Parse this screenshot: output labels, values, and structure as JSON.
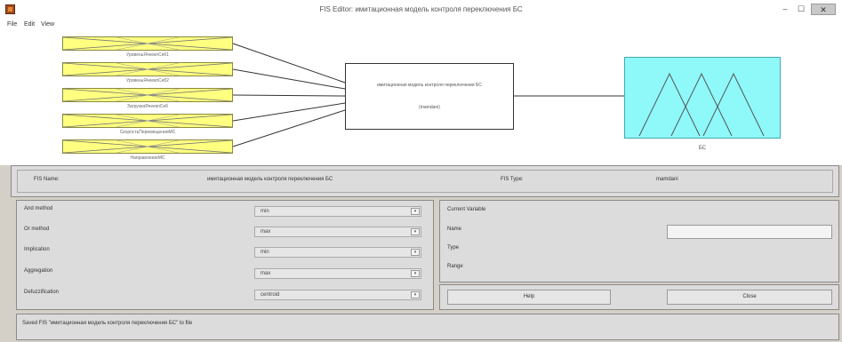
{
  "window": {
    "title": "FIS Editor: имитационная модель контроля переключения БС",
    "min_glyph": "‒",
    "max_glyph": "☐",
    "close_glyph": "✕"
  },
  "menu": [
    "File",
    "Edit",
    "View"
  ],
  "diagram": {
    "inputs": [
      "УровеньЯчеекпСеб1",
      "УровеньЯчеекпСеб2",
      "ЗагрузкаЯчеекпСеб",
      "СкоростьПеремещенияМС",
      "НаправлениеМС"
    ],
    "system_name": "имитационная модель контроля переключения БС",
    "system_type": "(mamdani)",
    "output": "БС",
    "colors": {
      "input_fill": "#ffff80",
      "output_fill": "#8ff8f8"
    }
  },
  "fis_info": {
    "name_label": "FIS Name:",
    "name_value": "имитационная модель контроля переключения БС",
    "type_label": "FIS Type:",
    "type_value": "mamdani"
  },
  "methods": [
    {
      "label": "And method",
      "value": "min"
    },
    {
      "label": "Or method",
      "value": "max"
    },
    {
      "label": "Implication",
      "value": "min"
    },
    {
      "label": "Aggregation",
      "value": "max"
    },
    {
      "label": "Defuzzification",
      "value": "centroid"
    }
  ],
  "current_variable": {
    "title": "Current Variable",
    "name_label": "Name",
    "type_label": "Type",
    "range_label": "Range",
    "name_value": ""
  },
  "buttons": {
    "help": "Help",
    "close": "Close"
  },
  "status": "Saved FIS \"имитационная модель контроля переключения БС\" to file",
  "select_arrow": "▾"
}
